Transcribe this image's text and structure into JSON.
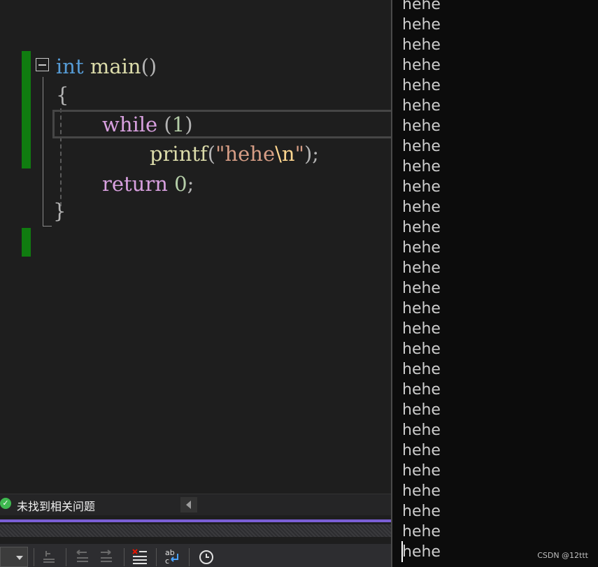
{
  "editor": {
    "lines": [
      {
        "tokens": [
          {
            "t": "int",
            "c": "kw-int"
          },
          {
            "t": " ",
            "c": ""
          },
          {
            "t": "main",
            "c": "fn"
          },
          {
            "t": "()",
            "c": "punct"
          }
        ]
      },
      {
        "tokens": [
          {
            "t": "{",
            "c": "punct"
          }
        ]
      },
      {
        "tokens": [
          {
            "t": "while",
            "c": "kw-ctrl"
          },
          {
            "t": " (",
            "c": "punct"
          },
          {
            "t": "1",
            "c": "num"
          },
          {
            "t": ")",
            "c": "punct"
          }
        ]
      },
      {
        "tokens": [
          {
            "t": "printf",
            "c": "fn"
          },
          {
            "t": "(",
            "c": "punct"
          },
          {
            "t": "\"hehe",
            "c": "str"
          },
          {
            "t": "\\n",
            "c": "esc"
          },
          {
            "t": "\"",
            "c": "str"
          },
          {
            "t": ");",
            "c": "punct"
          }
        ]
      },
      {
        "tokens": [
          {
            "t": "return",
            "c": "kw-ctrl"
          },
          {
            "t": " ",
            "c": ""
          },
          {
            "t": "0",
            "c": "num"
          },
          {
            "t": ";",
            "c": "punct"
          }
        ]
      },
      {
        "tokens": [
          {
            "t": "}",
            "c": "punct"
          }
        ]
      }
    ]
  },
  "status": {
    "message": "未找到相关问题",
    "icon": "check-circle-icon",
    "accent_color": "#7a5fd4"
  },
  "toolbar": {
    "icons": [
      "dropdown-icon",
      "comment-out-icon",
      "outdent-icon",
      "indent-icon",
      "remove-errors-icon",
      "replace-icon",
      "history-clock-icon"
    ]
  },
  "console": {
    "lines": [
      "hehe",
      "hehe",
      "hehe",
      "hehe",
      "hehe",
      "hehe",
      "hehe",
      "hehe",
      "hehe",
      "hehe",
      "hehe",
      "hehe",
      "hehe",
      "hehe",
      "hehe",
      "hehe",
      "hehe",
      "hehe",
      "hehe",
      "hehe",
      "hehe",
      "hehe",
      "hehe",
      "hehe",
      "hehe",
      "hehe",
      "hehe",
      "hehe"
    ],
    "watermark": "CSDN @12ttt"
  }
}
